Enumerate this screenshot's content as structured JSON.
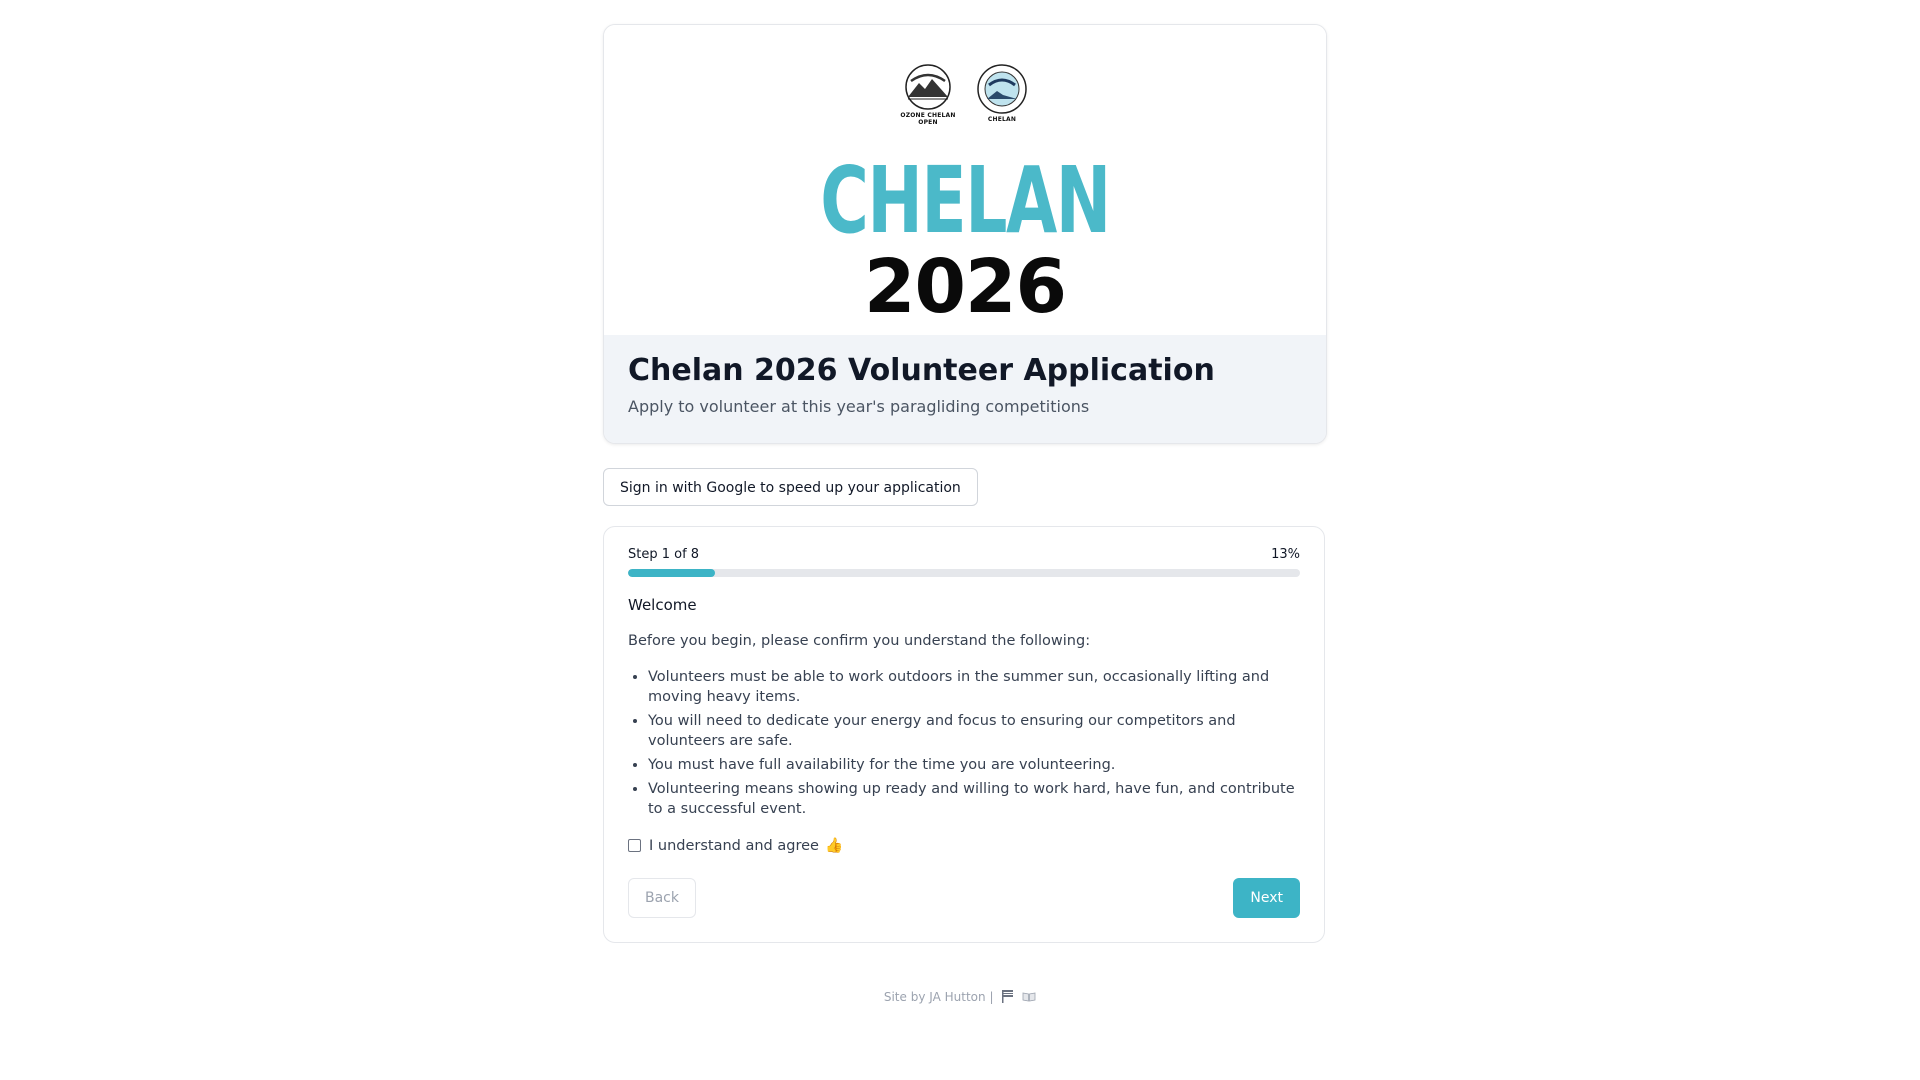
{
  "banner": {
    "logo_left_caption": "OZONE CHELAN OPEN",
    "logo_right_caption": "CHELAN",
    "wordmark_top": "CHELAN",
    "wordmark_bottom": "2026"
  },
  "header": {
    "title": "Chelan 2026 Volunteer Application",
    "subtitle": "Apply to volunteer at this year's paragliding competitions"
  },
  "google_signin": {
    "label": "Sign in with Google to speed up your application"
  },
  "progress": {
    "step_label": "Step 1 of 8",
    "percent_label": "13%",
    "fraction": 0.13
  },
  "step": {
    "heading": "Welcome",
    "intro": "Before you begin, please confirm you understand the following:",
    "rules": [
      "Volunteers must be able to work outdoors in the summer sun, occasionally lifting and moving heavy items.",
      "You will need to dedicate your energy and focus to ensuring our competitors and volunteers are safe.",
      "You must have full availability for the time you are volunteering.",
      "Volunteering means showing up ready and willing to work hard, have fun, and contribute to a successful event."
    ],
    "agree_label": "I understand and agree",
    "agree_emoji": "👍",
    "agree_checked": false
  },
  "buttons": {
    "back": "Back",
    "next": "Next"
  },
  "footer": {
    "prefix": "Site by",
    "author": "JA Hutton",
    "separator": "|"
  },
  "colors": {
    "accent": "#3db4c6",
    "wordmark_teal": "#4bb9c9",
    "title_bg": "#f1f4f8"
  }
}
